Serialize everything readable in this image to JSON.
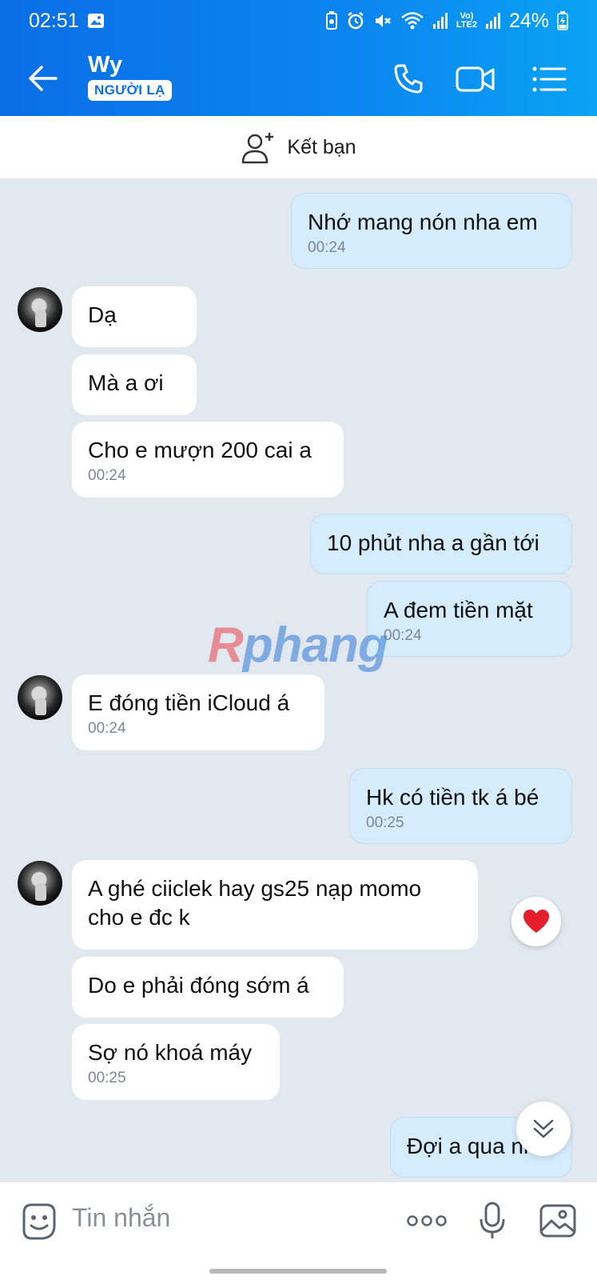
{
  "status_bar": {
    "time": "02:51",
    "battery": "24%",
    "network_label": "LTE2",
    "icons": [
      "gallery-icon",
      "battery-saver-icon",
      "alarm-icon",
      "mute-icon",
      "wifi-icon",
      "signal-icon",
      "volte-icon",
      "signal-icon",
      "battery-charging-icon"
    ]
  },
  "header": {
    "contact_name": "Wy",
    "badge": "NGƯỜI LẠ",
    "actions": [
      "phone-icon",
      "video-call-icon",
      "menu-list-icon"
    ],
    "color_start": "#0a6ee6",
    "color_end": "#0aa3f3"
  },
  "add_friend": {
    "label": "Kết bạn"
  },
  "messages": [
    {
      "dir": "out",
      "text": "Nhớ mang nón nha em",
      "time": "00:24"
    },
    {
      "dir": "in",
      "text": "Dạ",
      "time": ""
    },
    {
      "dir": "in",
      "text": "Mà a ơi",
      "time": ""
    },
    {
      "dir": "in",
      "text": "Cho e mượn 200 cai a",
      "time": "00:24"
    },
    {
      "dir": "out",
      "text": "10 phủt nha a gần tới",
      "time": ""
    },
    {
      "dir": "out",
      "text": "A đem tiền mặt",
      "time": "00:24"
    },
    {
      "dir": "in",
      "text": "E đóng tiền iCloud á",
      "time": "00:24"
    },
    {
      "dir": "out",
      "text": "Hk có tiền tk á bé",
      "time": "00:25"
    },
    {
      "dir": "in",
      "text": "A ghé ciiclek hay gs25 nạp momo cho e đc k",
      "time": ""
    },
    {
      "dir": "in",
      "text": "Do e phải đóng sớm á",
      "time": ""
    },
    {
      "dir": "in",
      "text": "Sợ nó khoá máy",
      "time": "00:25"
    },
    {
      "dir": "out",
      "text": "Đợi a qua nha",
      "time": ""
    }
  ],
  "reaction": "heart-icon",
  "watermark": {
    "part1": "R",
    "part2": "phang"
  },
  "input": {
    "placeholder": "Tin nhắn",
    "actions": [
      "more-dots-icon",
      "microphone-icon",
      "image-icon"
    ]
  }
}
